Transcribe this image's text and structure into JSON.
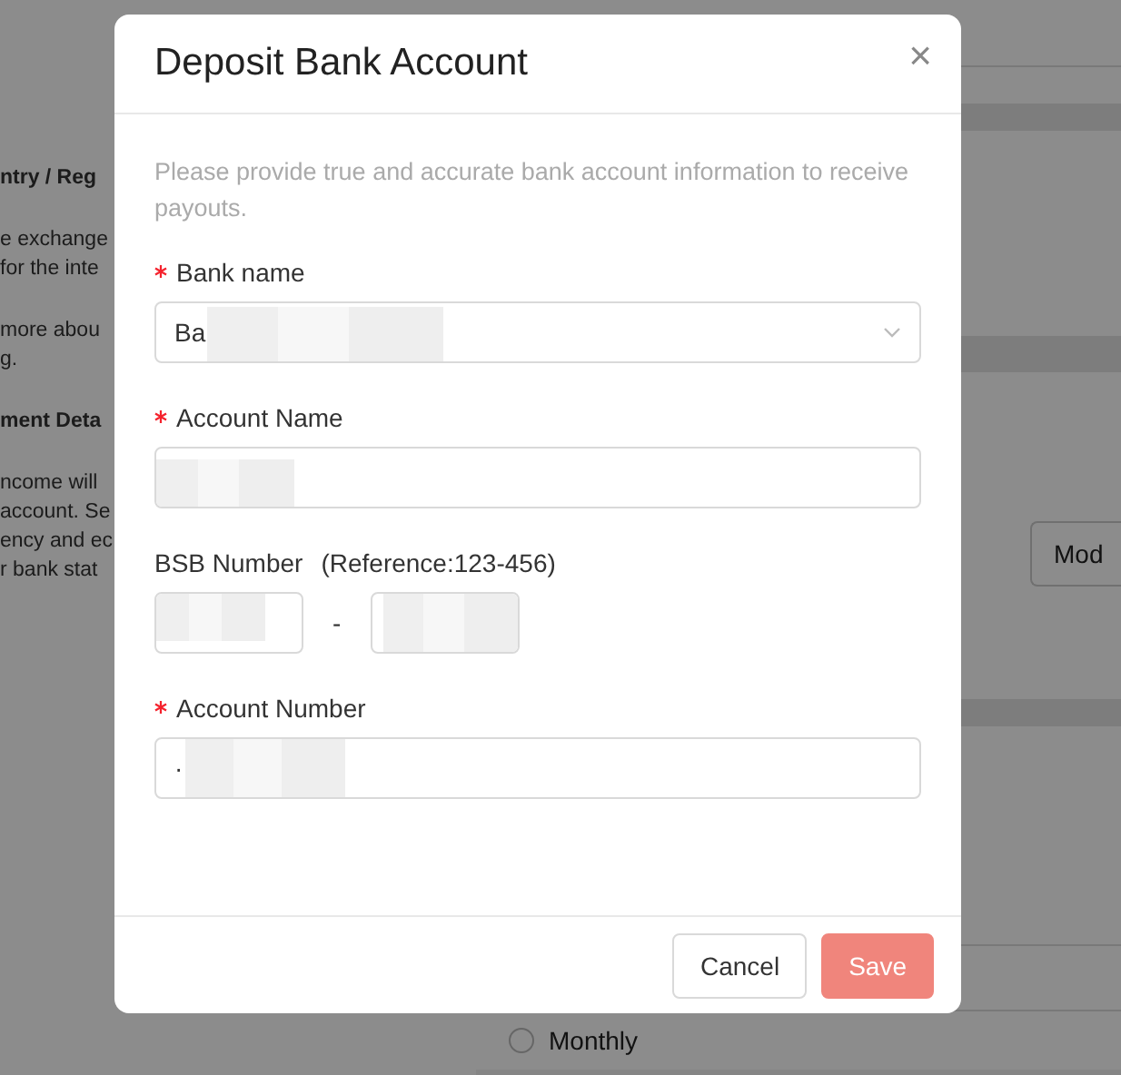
{
  "background": {
    "left_lines": [
      {
        "text": "ntry / Reg",
        "bold": true
      },
      {
        "text": "e exchange",
        "bold": false
      },
      {
        "text": "for the inte",
        "bold": false
      },
      {
        "text": "more abou",
        "bold": false
      },
      {
        "text": "g.",
        "bold": false
      },
      {
        "text": "ment Deta",
        "bold": true
      },
      {
        "text": "ncome will",
        "bold": false
      },
      {
        "text": "account. Se",
        "bold": false
      },
      {
        "text": "ency and ec",
        "bold": false
      },
      {
        "text": "r bank stat",
        "bold": false
      }
    ],
    "modify_button": "Mod",
    "frequency_option": {
      "label": "Monthly",
      "selected": false
    }
  },
  "dialog": {
    "title": "Deposit Bank Account",
    "close": "×",
    "description": "Please provide true and accurate bank account information to receive payouts.",
    "fields": [
      {
        "kind": "select",
        "label": "Bank name",
        "required": true,
        "value": "Ba"
      },
      {
        "kind": "text",
        "label": "Account Name",
        "required": true
      },
      {
        "kind": "bsb",
        "label": "BSB Number",
        "hint": "(Reference:123-456)",
        "required": false,
        "separator": "-"
      },
      {
        "kind": "text",
        "label": "Account Number",
        "required": true,
        "value": "·"
      }
    ],
    "buttons": [
      {
        "label": "Cancel",
        "kind": "default"
      },
      {
        "label": "Save",
        "kind": "primary"
      }
    ]
  }
}
